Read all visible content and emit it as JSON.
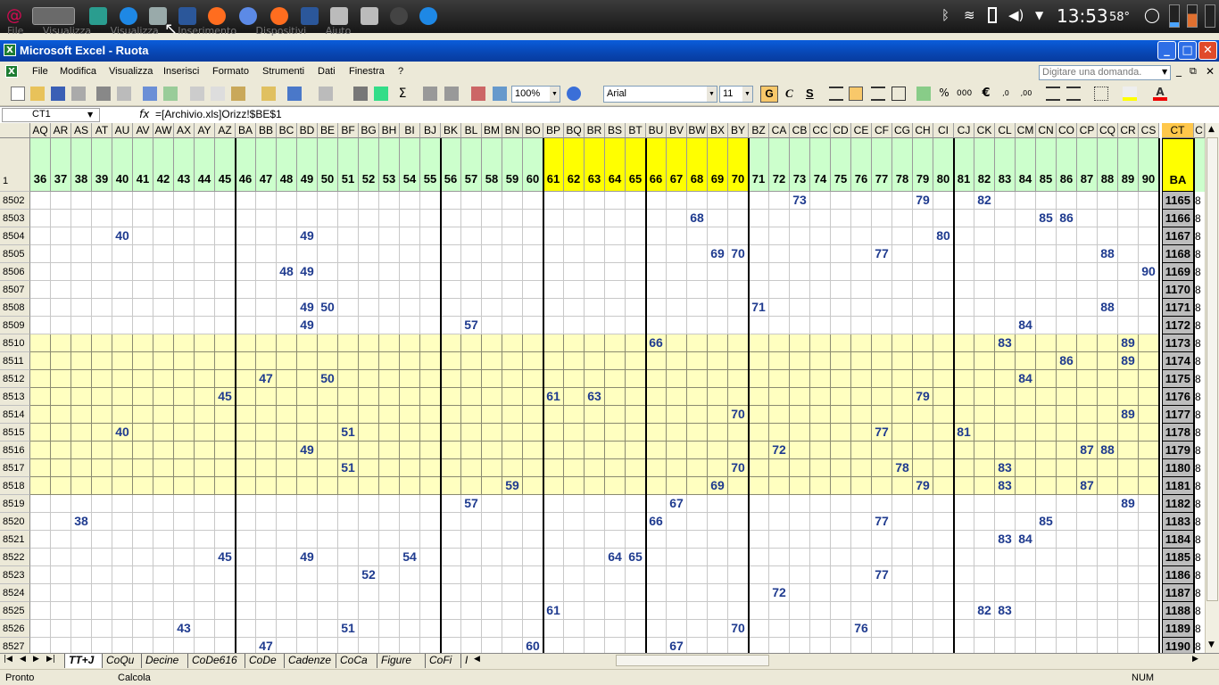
{
  "taskbar": {
    "clock": "13:53",
    "temperature": "58°",
    "hidden_menu": "File Visualizza Visualizza Inserimento Dispositivi Aiuto"
  },
  "window": {
    "title": "Microsoft Excel - Ruota"
  },
  "menubar": {
    "items": [
      "File",
      "Modifica",
      "Visualizza",
      "Inserisci",
      "Formato",
      "Strumenti",
      "Dati",
      "Finestra",
      "?"
    ],
    "ask_placeholder": "Digitare una domanda."
  },
  "toolbar": {
    "zoom": "100%",
    "font": "Arial",
    "font_size": "11",
    "bold": "G",
    "italic": "C",
    "underline": "S"
  },
  "formula_bar": {
    "name_box": "CT1",
    "fx": "fx",
    "formula": "=[Archivio.xls]Orizz!$BE$1"
  },
  "columns": [
    "AQ",
    "AR",
    "AS",
    "AT",
    "AU",
    "AV",
    "AW",
    "AX",
    "AY",
    "AZ",
    "BA",
    "BB",
    "BC",
    "BD",
    "BE",
    "BF",
    "BG",
    "BH",
    "BI",
    "BJ",
    "BK",
    "BL",
    "BM",
    "BN",
    "BO",
    "BP",
    "BQ",
    "BR",
    "BS",
    "BT",
    "BU",
    "BV",
    "BW",
    "BX",
    "BY",
    "BZ",
    "CA",
    "CB",
    "CC",
    "CD",
    "CE",
    "CF",
    "CG",
    "CH",
    "CI",
    "CJ",
    "CK",
    "CL",
    "CM",
    "CN",
    "CO",
    "CP",
    "CQ",
    "CR",
    "CS",
    "CT",
    "C"
  ],
  "header_row": {
    "row_number": "1",
    "numbers": [
      "36",
      "37",
      "38",
      "39",
      "40",
      "41",
      "42",
      "43",
      "44",
      "45",
      "46",
      "47",
      "48",
      "49",
      "50",
      "51",
      "52",
      "53",
      "54",
      "55",
      "56",
      "57",
      "58",
      "59",
      "60",
      "61",
      "62",
      "63",
      "64",
      "65",
      "66",
      "67",
      "68",
      "69",
      "70",
      "71",
      "72",
      "73",
      "74",
      "75",
      "76",
      "77",
      "78",
      "79",
      "80",
      "81",
      "82",
      "83",
      "84",
      "85",
      "86",
      "87",
      "88",
      "89",
      "90"
    ],
    "ct_value": "BA"
  },
  "rows": [
    {
      "n": "8502",
      "ct": "1165",
      "v": [
        "CB:73",
        "CH:79",
        "CK:82"
      ]
    },
    {
      "n": "8503",
      "ct": "1166",
      "v": [
        "BW:68",
        "CN:85",
        "CO:86"
      ]
    },
    {
      "n": "8504",
      "ct": "1167",
      "v": [
        "AU:40",
        "BD:49",
        "CI:80"
      ]
    },
    {
      "n": "8505",
      "ct": "1168",
      "v": [
        "BX:69",
        "BY:70",
        "CF:77",
        "CQ:88"
      ]
    },
    {
      "n": "8506",
      "ct": "1169",
      "v": [
        "BC:48",
        "BD:49",
        "CS:90"
      ]
    },
    {
      "n": "8507",
      "ct": "1170",
      "v": []
    },
    {
      "n": "8508",
      "ct": "1171",
      "v": [
        "BD:49",
        "BE:50",
        "BZ:71",
        "CQ:88"
      ]
    },
    {
      "n": "8509",
      "ct": "1172",
      "v": [
        "BD:49",
        "BL:57",
        "CM:84"
      ]
    },
    {
      "n": "8510",
      "ct": "1173",
      "v": [
        "BU:66",
        "CL:83",
        "CR:89"
      ]
    },
    {
      "n": "8511",
      "ct": "1174",
      "v": [
        "CO:86",
        "CR:89"
      ]
    },
    {
      "n": "8512",
      "ct": "1175",
      "v": [
        "BB:47",
        "BE:50",
        "CM:84"
      ]
    },
    {
      "n": "8513",
      "ct": "1176",
      "v": [
        "AZ:45",
        "BP:61",
        "BR:63",
        "CH:79"
      ]
    },
    {
      "n": "8514",
      "ct": "1177",
      "v": [
        "BY:70",
        "CR:89"
      ]
    },
    {
      "n": "8515",
      "ct": "1178",
      "v": [
        "AU:40",
        "BF:51",
        "CF:77",
        "CJ:81"
      ]
    },
    {
      "n": "8516",
      "ct": "1179",
      "v": [
        "BD:49",
        "CA:72",
        "CP:87",
        "CQ:88"
      ]
    },
    {
      "n": "8517",
      "ct": "1180",
      "v": [
        "BF:51",
        "BY:70",
        "CG:78",
        "CL:83"
      ]
    },
    {
      "n": "8518",
      "ct": "1181",
      "v": [
        "BN:59",
        "BX:69",
        "CH:79",
        "CL:83",
        "CP:87"
      ]
    },
    {
      "n": "8519",
      "ct": "1182",
      "v": [
        "BL:57",
        "BV:67",
        "CR:89"
      ]
    },
    {
      "n": "8520",
      "ct": "1183",
      "v": [
        "AS:38",
        "BU:66",
        "CF:77",
        "CN:85"
      ]
    },
    {
      "n": "8521",
      "ct": "1184",
      "v": [
        "CL:83",
        "CM:84"
      ]
    },
    {
      "n": "8522",
      "ct": "1185",
      "v": [
        "AZ:45",
        "BD:49",
        "BI:54",
        "BS:64",
        "BT:65"
      ]
    },
    {
      "n": "8523",
      "ct": "1186",
      "v": [
        "BG:52",
        "CF:77"
      ]
    },
    {
      "n": "8524",
      "ct": "1187",
      "v": [
        "CA:72"
      ]
    },
    {
      "n": "8525",
      "ct": "1188",
      "v": [
        "BP:61",
        "CK:82",
        "CL:83"
      ]
    },
    {
      "n": "8526",
      "ct": "1189",
      "v": [
        "AX:43",
        "BF:51",
        "BY:70",
        "CE:76"
      ]
    },
    {
      "n": "8527",
      "ct": "1190",
      "v": [
        "BB:47",
        "BO:60",
        "BV:67"
      ]
    }
  ],
  "highlight_rows": [
    "8510",
    "8511",
    "8512",
    "8513",
    "8514",
    "8515",
    "8516",
    "8517",
    "8518"
  ],
  "edge_char": "8",
  "sheet_tabs": [
    "TT+J",
    "CoQu",
    "Decine",
    "CoDe616",
    "CoDe",
    "Cadenze",
    "CoCa",
    "Figure",
    "CoFi",
    "I"
  ],
  "status": {
    "left": "Pronto",
    "middle": "Calcola",
    "num": "NUM"
  },
  "colors": {
    "header_green": "#ccffcc",
    "header_yellow": "#ffff00",
    "band_yellow": "#ffffc0",
    "value_blue": "#1f3b8f",
    "title_blue": "#0a5ddb"
  }
}
